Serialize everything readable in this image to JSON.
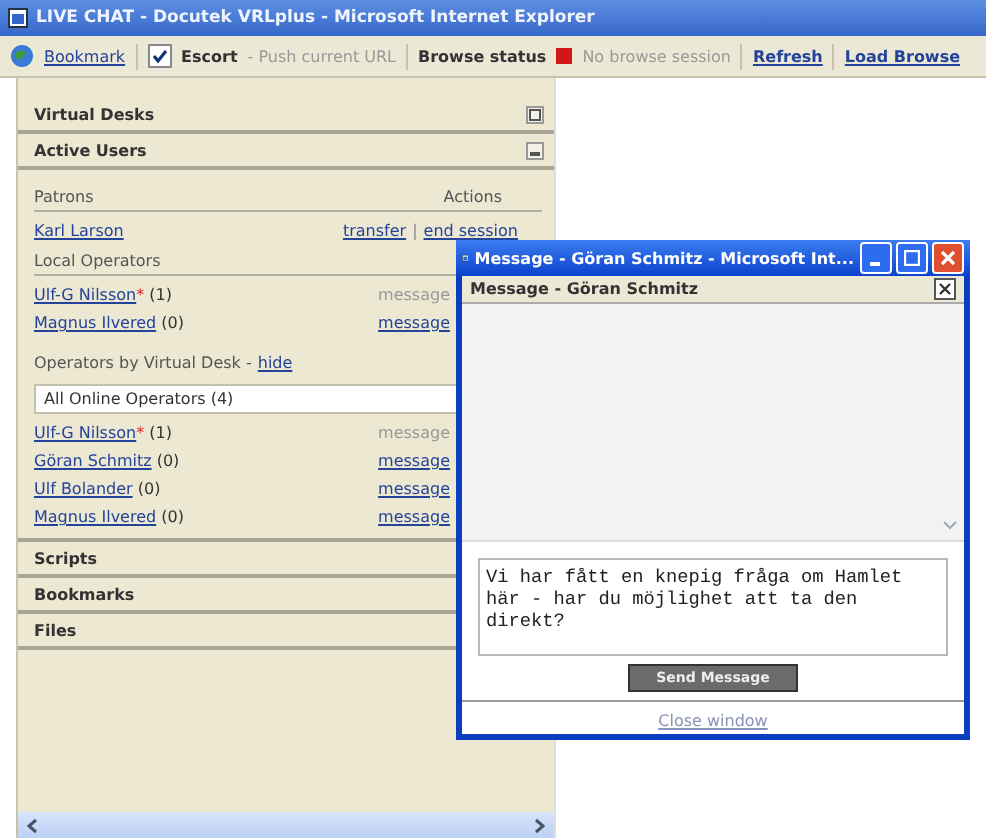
{
  "window": {
    "title": "LIVE CHAT - Docutek VRLplus - Microsoft Internet Explorer"
  },
  "toolbar": {
    "bookmark": "Bookmark",
    "escort": {
      "label": "Escort",
      "checked": true
    },
    "push": "- Push current URL",
    "browse_status": "Browse status",
    "status_text": "No browse session",
    "refresh": "Refresh",
    "load": "Load Browse"
  },
  "sections": [
    {
      "title": "Virtual Desks",
      "expanded": false
    },
    {
      "title": "Active Users",
      "expanded": true
    },
    {
      "title": "Scripts",
      "expanded": false
    },
    {
      "title": "Bookmarks",
      "expanded": false
    },
    {
      "title": "Files",
      "expanded": false
    }
  ],
  "active_users": {
    "patrons_heading": "Patrons",
    "actions_heading": "Actions",
    "patrons": [
      {
        "name": "Karl Larson",
        "actions": [
          "transfer",
          "end session"
        ],
        "separator": "|"
      }
    ],
    "local_heading": "Local Operators",
    "local_operators": [
      {
        "name": "Ulf-G Nilsson",
        "mark": "*",
        "count": "(1)",
        "action": "message",
        "disabled": true
      },
      {
        "name": "Magnus Ilvered",
        "count": "(0)",
        "action": "message",
        "disabled": false
      }
    ],
    "desk_heading": "Operators by Virtual Desk -",
    "desk_toggle": "hide",
    "desk_select": "All Online Operators (4)",
    "desk_operators": [
      {
        "name": "Ulf-G Nilsson",
        "mark": "*",
        "count": "(1)",
        "action": "message",
        "disabled": true
      },
      {
        "name": "Göran Schmitz",
        "count": "(0)",
        "action": "message",
        "disabled": false
      },
      {
        "name": "Ulf Bolander",
        "count": "(0)",
        "action": "message",
        "disabled": false
      },
      {
        "name": "Magnus Ilvered",
        "count": "(0)",
        "action": "message",
        "disabled": false
      }
    ]
  },
  "popup": {
    "title": "Message - Göran Schmitz - Microsoft Int...",
    "header": "Message - Göran Schmitz",
    "message": "Vi har fått en knepig fråga om Hamlet här - har du möjlighet att ta den direkt?",
    "send": "Send Message",
    "close": "Close window"
  }
}
